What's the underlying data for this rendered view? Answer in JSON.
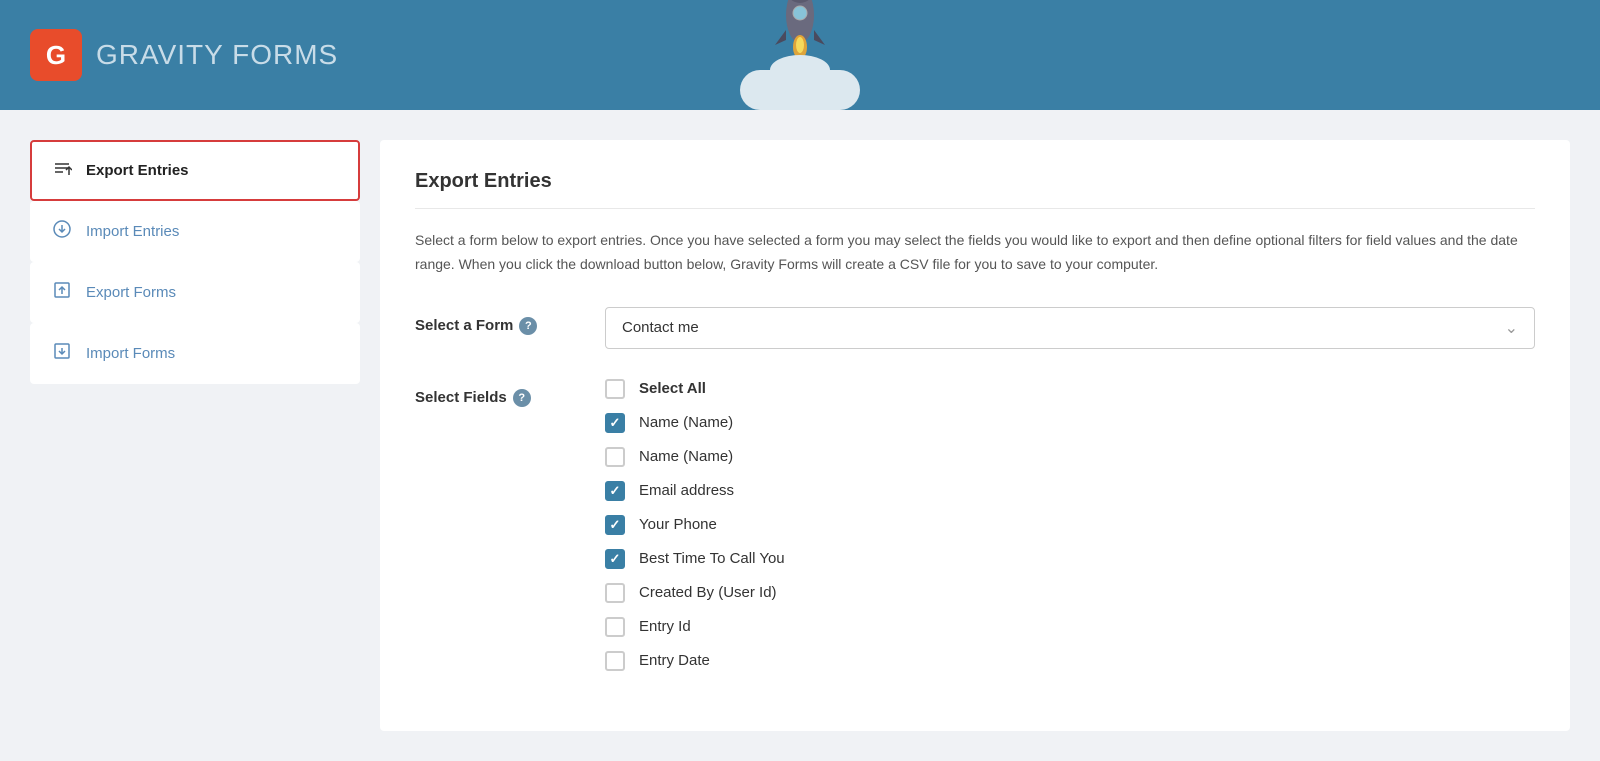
{
  "header": {
    "logo_text": "GRAVITY",
    "logo_subtext": " FORMS",
    "logo_letter": "G"
  },
  "sidebar": {
    "items": [
      {
        "id": "export-entries",
        "label": "Export Entries",
        "icon": "⇪",
        "active": true
      },
      {
        "id": "import-entries",
        "label": "Import Entries",
        "icon": "↻",
        "active": false
      },
      {
        "id": "export-forms",
        "label": "Export Forms",
        "icon": "⬆",
        "active": false
      },
      {
        "id": "import-forms",
        "label": "Import Forms",
        "icon": "⬇",
        "active": false
      }
    ]
  },
  "main": {
    "title": "Export Entries",
    "description": "Select a form below to export entries. Once you have selected a form you may select the fields you would like to export and then define optional filters for field values and the date range. When you click the download button below, Gravity Forms will create a CSV file for you to save to your computer.",
    "select_form_label": "Select a Form",
    "select_form_value": "Contact me",
    "select_fields_label": "Select Fields",
    "fields": [
      {
        "id": "select-all",
        "label": "Select All",
        "checked": false,
        "bold": true
      },
      {
        "id": "name-1",
        "label": "Name (Name)",
        "checked": true
      },
      {
        "id": "name-2",
        "label": "Name (Name)",
        "checked": false
      },
      {
        "id": "email",
        "label": "Email address",
        "checked": true
      },
      {
        "id": "phone",
        "label": "Your Phone",
        "checked": true
      },
      {
        "id": "best-time",
        "label": "Best Time To Call You",
        "checked": true
      },
      {
        "id": "created-by",
        "label": "Created By (User Id)",
        "checked": false
      },
      {
        "id": "entry-id",
        "label": "Entry Id",
        "checked": false
      },
      {
        "id": "entry-date",
        "label": "Entry Date",
        "checked": false
      }
    ]
  }
}
